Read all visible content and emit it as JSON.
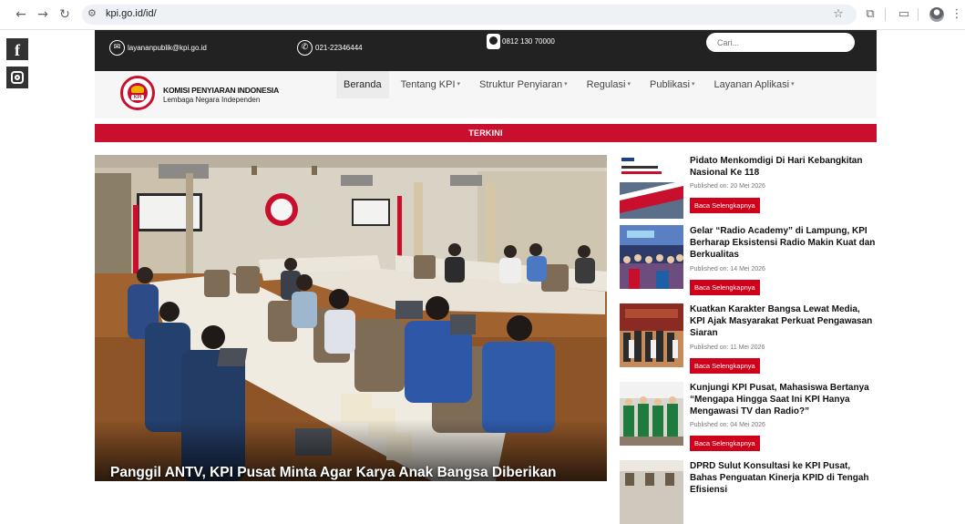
{
  "browser": {
    "url": "kpi.go.id/id/",
    "icons": [
      "back-icon",
      "forward-icon",
      "reload-icon",
      "site-settings-icon",
      "bookmark-star-icon",
      "extensions-icon",
      "cast-icon",
      "profile-avatar",
      "menu-kebab-icon"
    ]
  },
  "social": {
    "facebook_glyph": "f",
    "icons": [
      "facebook-icon",
      "instagram-icon"
    ]
  },
  "topbar": {
    "email": "layananpublik@kpi.go.id",
    "phone": "021-22346444",
    "whatsapp": "0812 130 70000",
    "search_placeholder": "Cari..."
  },
  "header": {
    "brand_name": "KOMISI PENYIARAN INDONESIA",
    "brand_sub": "Lembaga Negara Independen",
    "menu": [
      {
        "label": "Beranda",
        "has_caret": false
      },
      {
        "label": "Tentang KPI",
        "has_caret": true
      },
      {
        "label": "Struktur Penyiaran",
        "has_caret": true
      },
      {
        "label": "Regulasi",
        "has_caret": true
      },
      {
        "label": "Publikasi",
        "has_caret": true
      },
      {
        "label": "Layanan Aplikasi",
        "has_caret": true
      }
    ],
    "caret_glyph": "▾"
  },
  "section": {
    "label": "TERKINI"
  },
  "hero": {
    "caption": "Panggil ANTV, KPI Pusat Minta Agar Karya Anak Bangsa Diberikan"
  },
  "news": [
    {
      "title": "Pidato Menkomdigi Di Hari Kebangkitan Nasional Ke 118",
      "date": "Published on: 20 Mei 2026",
      "button": "Baca Selengkapnya"
    },
    {
      "title": "Gelar “Radio Academy” di Lampung, KPI Berharap Eksistensi Radio Makin Kuat dan Berkualitas",
      "date": "Published on: 14 Mei 2026",
      "button": "Baca Selengkapnya"
    },
    {
      "title": "Kuatkan Karakter Bangsa Lewat Media, KPI Ajak Masyarakat Perkuat Pengawasan Siaran",
      "date": "Published on: 11 Mei 2026",
      "button": "Baca Selengkapnya"
    },
    {
      "title": "Kunjungi KPI Pusat, Mahasiswa  Bertanya “Mengapa Hingga Saat Ini KPI Hanya Mengawasi TV dan Radio?”",
      "date": "Published on: 04 Mei 2026",
      "button": "Baca Selengkapnya"
    },
    {
      "title": "DPRD Sulut Konsultasi ke KPI Pusat, Bahas Penguatan Kinerja KPID di Tengah Efisiensi",
      "date": "",
      "button": ""
    }
  ],
  "colors": {
    "topbar_bg": "#222222",
    "accent_red": "#c8102e",
    "button_red": "#d0021b",
    "header_bg": "#f6f6f6"
  }
}
